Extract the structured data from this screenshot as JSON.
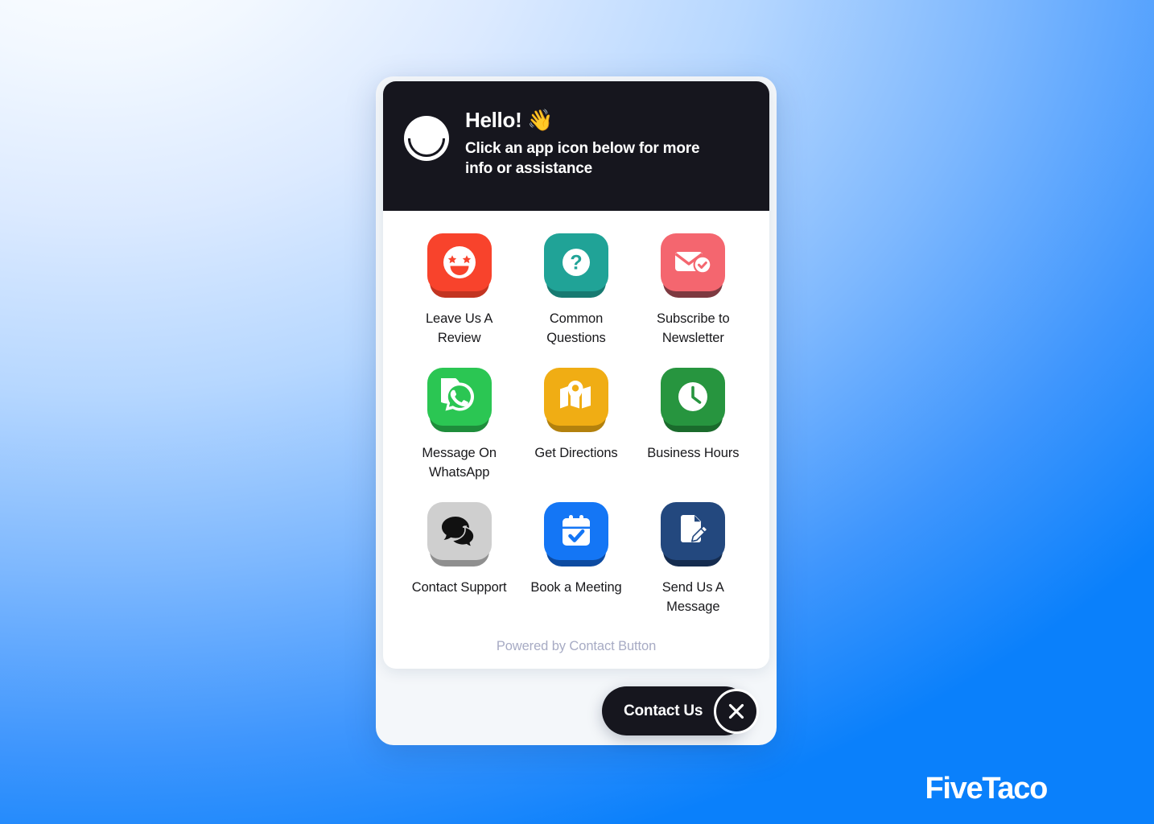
{
  "background": {
    "gradient_from": "#ffffff",
    "gradient_to": "#0a80fb"
  },
  "widget": {
    "header": {
      "avatar_icon": "avatar-crescent-circle-icon",
      "greeting": "Hello! 👋",
      "greeting_text": "Hello!",
      "wave_emoji": "👋",
      "subtitle": "Click an app icon below for more info or assistance",
      "background_color": "#16161e",
      "text_color": "#ffffff"
    },
    "apps": [
      {
        "label": "Leave Us A Review",
        "icon": "star-eyes-smiley-icon",
        "tile_color": "#f8432c",
        "shadow_color": "#c23421"
      },
      {
        "label": "Common Questions",
        "icon": "question-mark-circle-icon",
        "tile_color": "#20a397",
        "shadow_color": "#177a71"
      },
      {
        "label": "Subscribe to Newsletter",
        "icon": "envelope-check-icon",
        "tile_color": "#f4666f",
        "shadow_color": "#7d3940"
      },
      {
        "label": "Message On WhatsApp",
        "icon": "whatsapp-icon",
        "tile_color": "#2bc653",
        "shadow_color": "#1e8d3b"
      },
      {
        "label": "Get Directions",
        "icon": "map-pin-icon",
        "tile_color": "#f0ad14",
        "shadow_color": "#b3810d"
      },
      {
        "label": "Business Hours",
        "icon": "clock-icon",
        "tile_color": "#27953f",
        "shadow_color": "#1a6b2c"
      },
      {
        "label": "Contact Support",
        "icon": "chat-bubbles-icon",
        "tile_color": "#cfcfcf",
        "shadow_color": "#8f8f8f"
      },
      {
        "label": "Book a Meeting",
        "icon": "calendar-check-icon",
        "tile_color": "#1476f5",
        "shadow_color": "#0d4ba1"
      },
      {
        "label": "Send Us A Message",
        "icon": "document-pencil-icon",
        "tile_color": "#23487e",
        "shadow_color": "#152c4f"
      }
    ],
    "footer": {
      "powered_by": "Powered by Contact Button"
    },
    "contact_button": {
      "label": "Contact Us",
      "close_icon": "close-x-icon",
      "background_color": "#16161e"
    }
  },
  "brand": {
    "name": "FiveTaco"
  }
}
